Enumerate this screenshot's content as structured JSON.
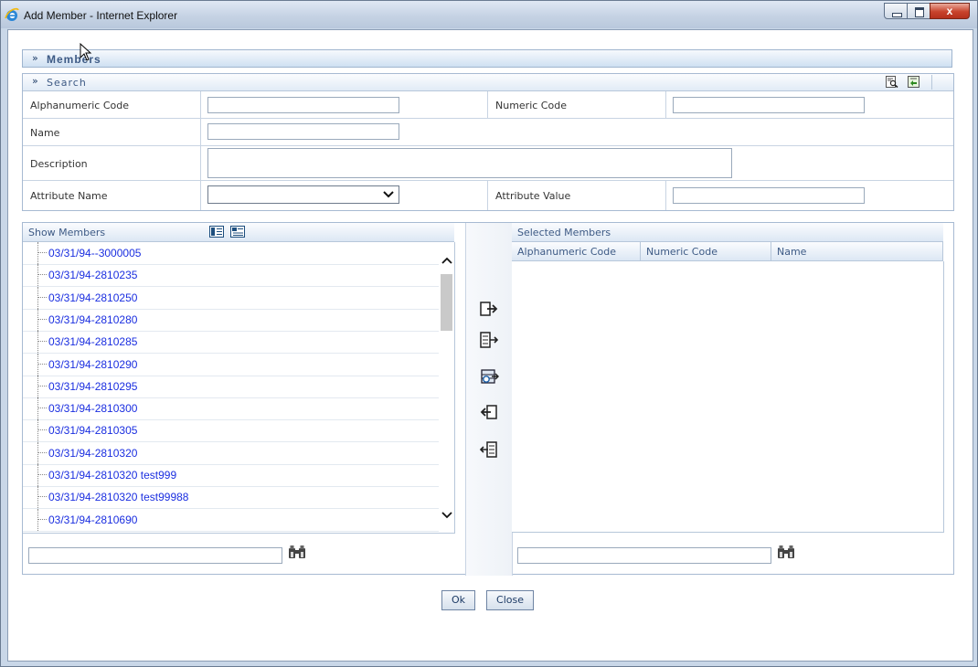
{
  "window": {
    "title": "Add Member - Internet Explorer",
    "close_glyph": "x"
  },
  "members_section": {
    "title": "Members",
    "chevron": "»"
  },
  "search": {
    "title": "Search",
    "chevron": "»",
    "fields": {
      "alphanumeric_code": {
        "label": "Alphanumeric Code",
        "value": ""
      },
      "numeric_code": {
        "label": "Numeric Code",
        "value": ""
      },
      "name": {
        "label": "Name",
        "value": ""
      },
      "description": {
        "label": "Description",
        "value": ""
      },
      "attribute_name": {
        "label": "Attribute Name",
        "selected": ""
      },
      "attribute_value": {
        "label": "Attribute Value",
        "value": ""
      }
    },
    "icons": [
      "search-icon",
      "reset-icon"
    ]
  },
  "show_members": {
    "title": "Show Members",
    "items": [
      "03/31/94--3000005",
      "03/31/94-2810235",
      "03/31/94-2810250",
      "03/31/94-2810280",
      "03/31/94-2810285",
      "03/31/94-2810290",
      "03/31/94-2810295",
      "03/31/94-2810300",
      "03/31/94-2810305",
      "03/31/94-2810320",
      "03/31/94-2810320 test999",
      "03/31/94-2810320 test99988",
      "03/31/94-2810690"
    ],
    "find_value": ""
  },
  "selected_members": {
    "title": "Selected Members",
    "columns": [
      "Alphanumeric Code",
      "Numeric Code",
      "Name"
    ],
    "rows": [],
    "find_value": ""
  },
  "buttons": {
    "ok": "Ok",
    "close": "Close"
  }
}
